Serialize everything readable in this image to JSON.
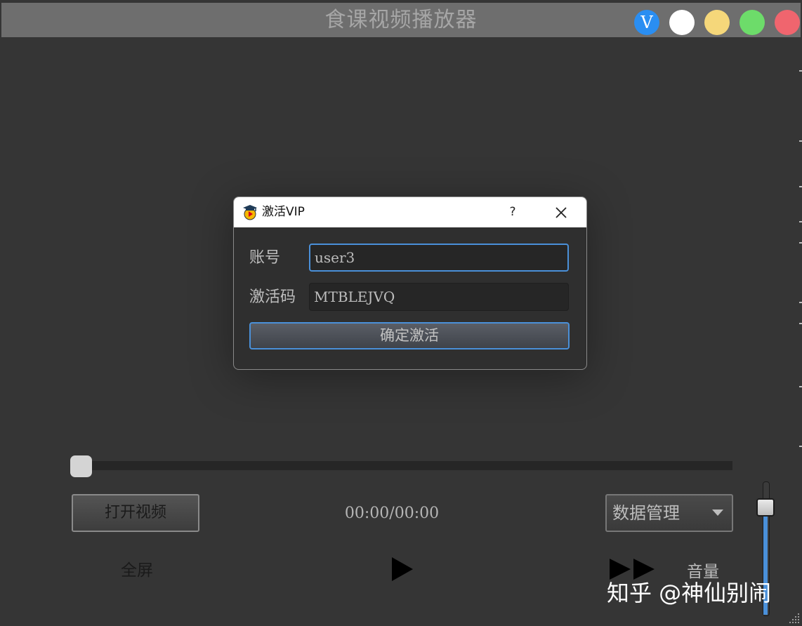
{
  "window": {
    "title": "食课视频播放器",
    "vip_badge": "V",
    "buttons": [
      "vip-button",
      "white-button",
      "minimize-button",
      "maximize-button",
      "close-button"
    ],
    "colors": {
      "background": "#353535",
      "titlebar": "#6e6e6e",
      "accent": "#4a90d9"
    }
  },
  "dialog": {
    "title": "激活VIP",
    "help": "?",
    "account_label": "账号",
    "account_value": "user3",
    "code_label": "激活码",
    "code_value": "MTBLEJVQ",
    "confirm_label": "确定激活"
  },
  "player": {
    "progress_fraction": 0,
    "open_button": "打开视频",
    "time": "00:00/00:00",
    "data_combo": "数据管理",
    "fullscreen": "全屏",
    "volume_label": "音量",
    "volume_fraction": 0.85
  },
  "watermark": "知乎 @神仙别闹"
}
